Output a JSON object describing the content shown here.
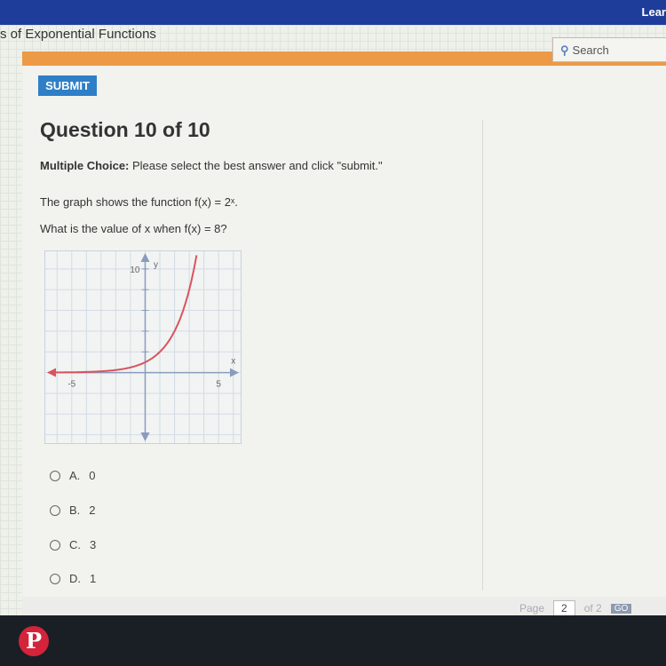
{
  "header": {
    "logo": "Lear",
    "breadcrumb": "s of Exponential Functions",
    "search_placeholder": "Search",
    "search_icon": "magnifier-icon"
  },
  "toolbar": {
    "submit_label": "SUBMIT"
  },
  "question": {
    "title": "Question 10 of 10",
    "instruction_bold": "Multiple Choice:",
    "instruction": " Please select the best answer and click \"submit.\"",
    "prompt1": "The graph shows the function f(x) = 2ˣ.",
    "prompt2": "What is the value of x when f(x) = 8?"
  },
  "graph": {
    "function": "2^x",
    "x_label": "x",
    "y_label": "y",
    "x_ticks": [
      "-5",
      "5"
    ],
    "y_ticks": [
      "10"
    ],
    "xlim": [
      -6.8,
      6.5
    ],
    "ylim": [
      -6.8,
      11.7
    ],
    "curve_color": "#d9535f",
    "axis_color": "#8a9bbd"
  },
  "options": [
    {
      "letter": "A.",
      "value": "0"
    },
    {
      "letter": "B.",
      "value": "2"
    },
    {
      "letter": "C.",
      "value": "3"
    },
    {
      "letter": "D.",
      "value": "1"
    }
  ],
  "footer": {
    "page_label": "Page",
    "page_value": "2",
    "of_label": "of 2",
    "go_label": "GO"
  },
  "taskbar": {
    "pinterest_icon": "P"
  }
}
